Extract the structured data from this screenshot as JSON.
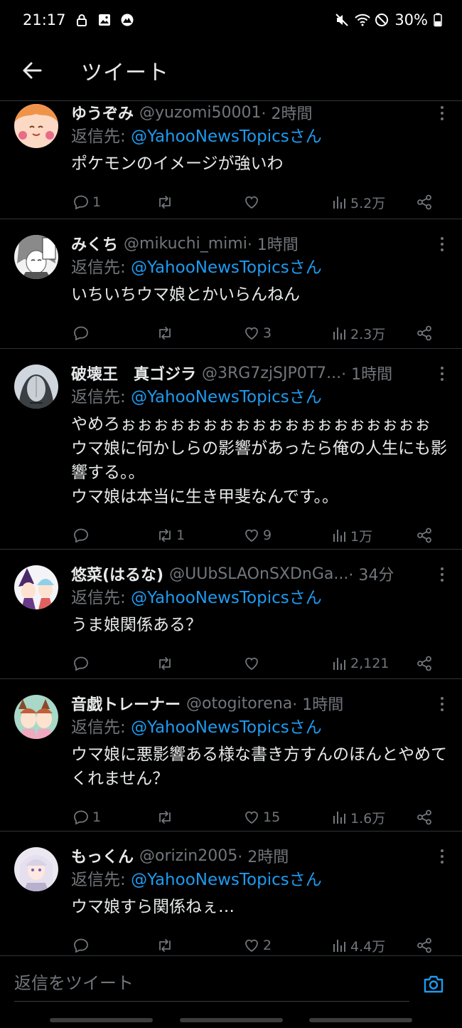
{
  "status_bar": {
    "time": "21:17",
    "battery": "30%"
  },
  "header": {
    "title": "ツイート"
  },
  "tweets": [
    {
      "name": "ゆうぞみ",
      "handle": "@yuzomi50001",
      "time": "· 2時間",
      "reply_prefix": "返信先: ",
      "reply_to": "@YahooNewsTopicsさん",
      "text": "ポケモンのイメージが強いわ",
      "replies": "1",
      "retweets": "",
      "likes": "",
      "views": "5.2万"
    },
    {
      "name": "みくち",
      "handle": "@mikuchi_mimi",
      "time": "· 1時間",
      "reply_prefix": "返信先: ",
      "reply_to": "@YahooNewsTopicsさん",
      "text": "いちいちウマ娘とかいらんねん",
      "replies": "",
      "retweets": "",
      "likes": "3",
      "views": "2.3万"
    },
    {
      "name": "破壊王　真ゴジラ",
      "handle": "@3RG7zjSJP0T7...",
      "time": "· 1時間",
      "reply_prefix": "返信先: ",
      "reply_to": "@YahooNewsTopicsさん",
      "text": "やめろぉぉぉぉぉぉぉぉぉぉぉぉぉぉぉぉぉぉぉ\nウマ娘に何かしらの影響があったら俺の人生にも影響する。。\nウマ娘は本当に生き甲斐なんです。。",
      "replies": "",
      "retweets": "1",
      "likes": "9",
      "views": "1万"
    },
    {
      "name": "悠菜(はるな)",
      "handle": "@UUbSLAOnSXDnGa...",
      "time": "· 34分",
      "reply_prefix": "返信先: ",
      "reply_to": "@YahooNewsTopicsさん",
      "text": "うま娘関係ある？",
      "replies": "",
      "retweets": "",
      "likes": "",
      "views": "2,121"
    },
    {
      "name": "音戯トレーナー",
      "handle": "@otogitorena",
      "time": "· 1時間",
      "reply_prefix": "返信先: ",
      "reply_to": "@YahooNewsTopicsさん",
      "text": "ウマ娘に悪影響ある様な書き方すんのほんとやめてくれません？",
      "replies": "1",
      "retweets": "",
      "likes": "15",
      "views": "1.6万"
    },
    {
      "name": "もっくん",
      "handle": "@orizin2005",
      "time": "· 2時間",
      "reply_prefix": "返信先: ",
      "reply_to": "@YahooNewsTopicsさん",
      "text": "ウマ娘すら関係ねぇ…",
      "replies": "",
      "retweets": "",
      "likes": "2",
      "views": "4.4万"
    }
  ],
  "reply_bar": {
    "placeholder": "返信をツイート"
  },
  "colors": {
    "background": "#000000",
    "link": "#1d9bf0",
    "muted": "#71767b",
    "divider": "#2f3336"
  }
}
